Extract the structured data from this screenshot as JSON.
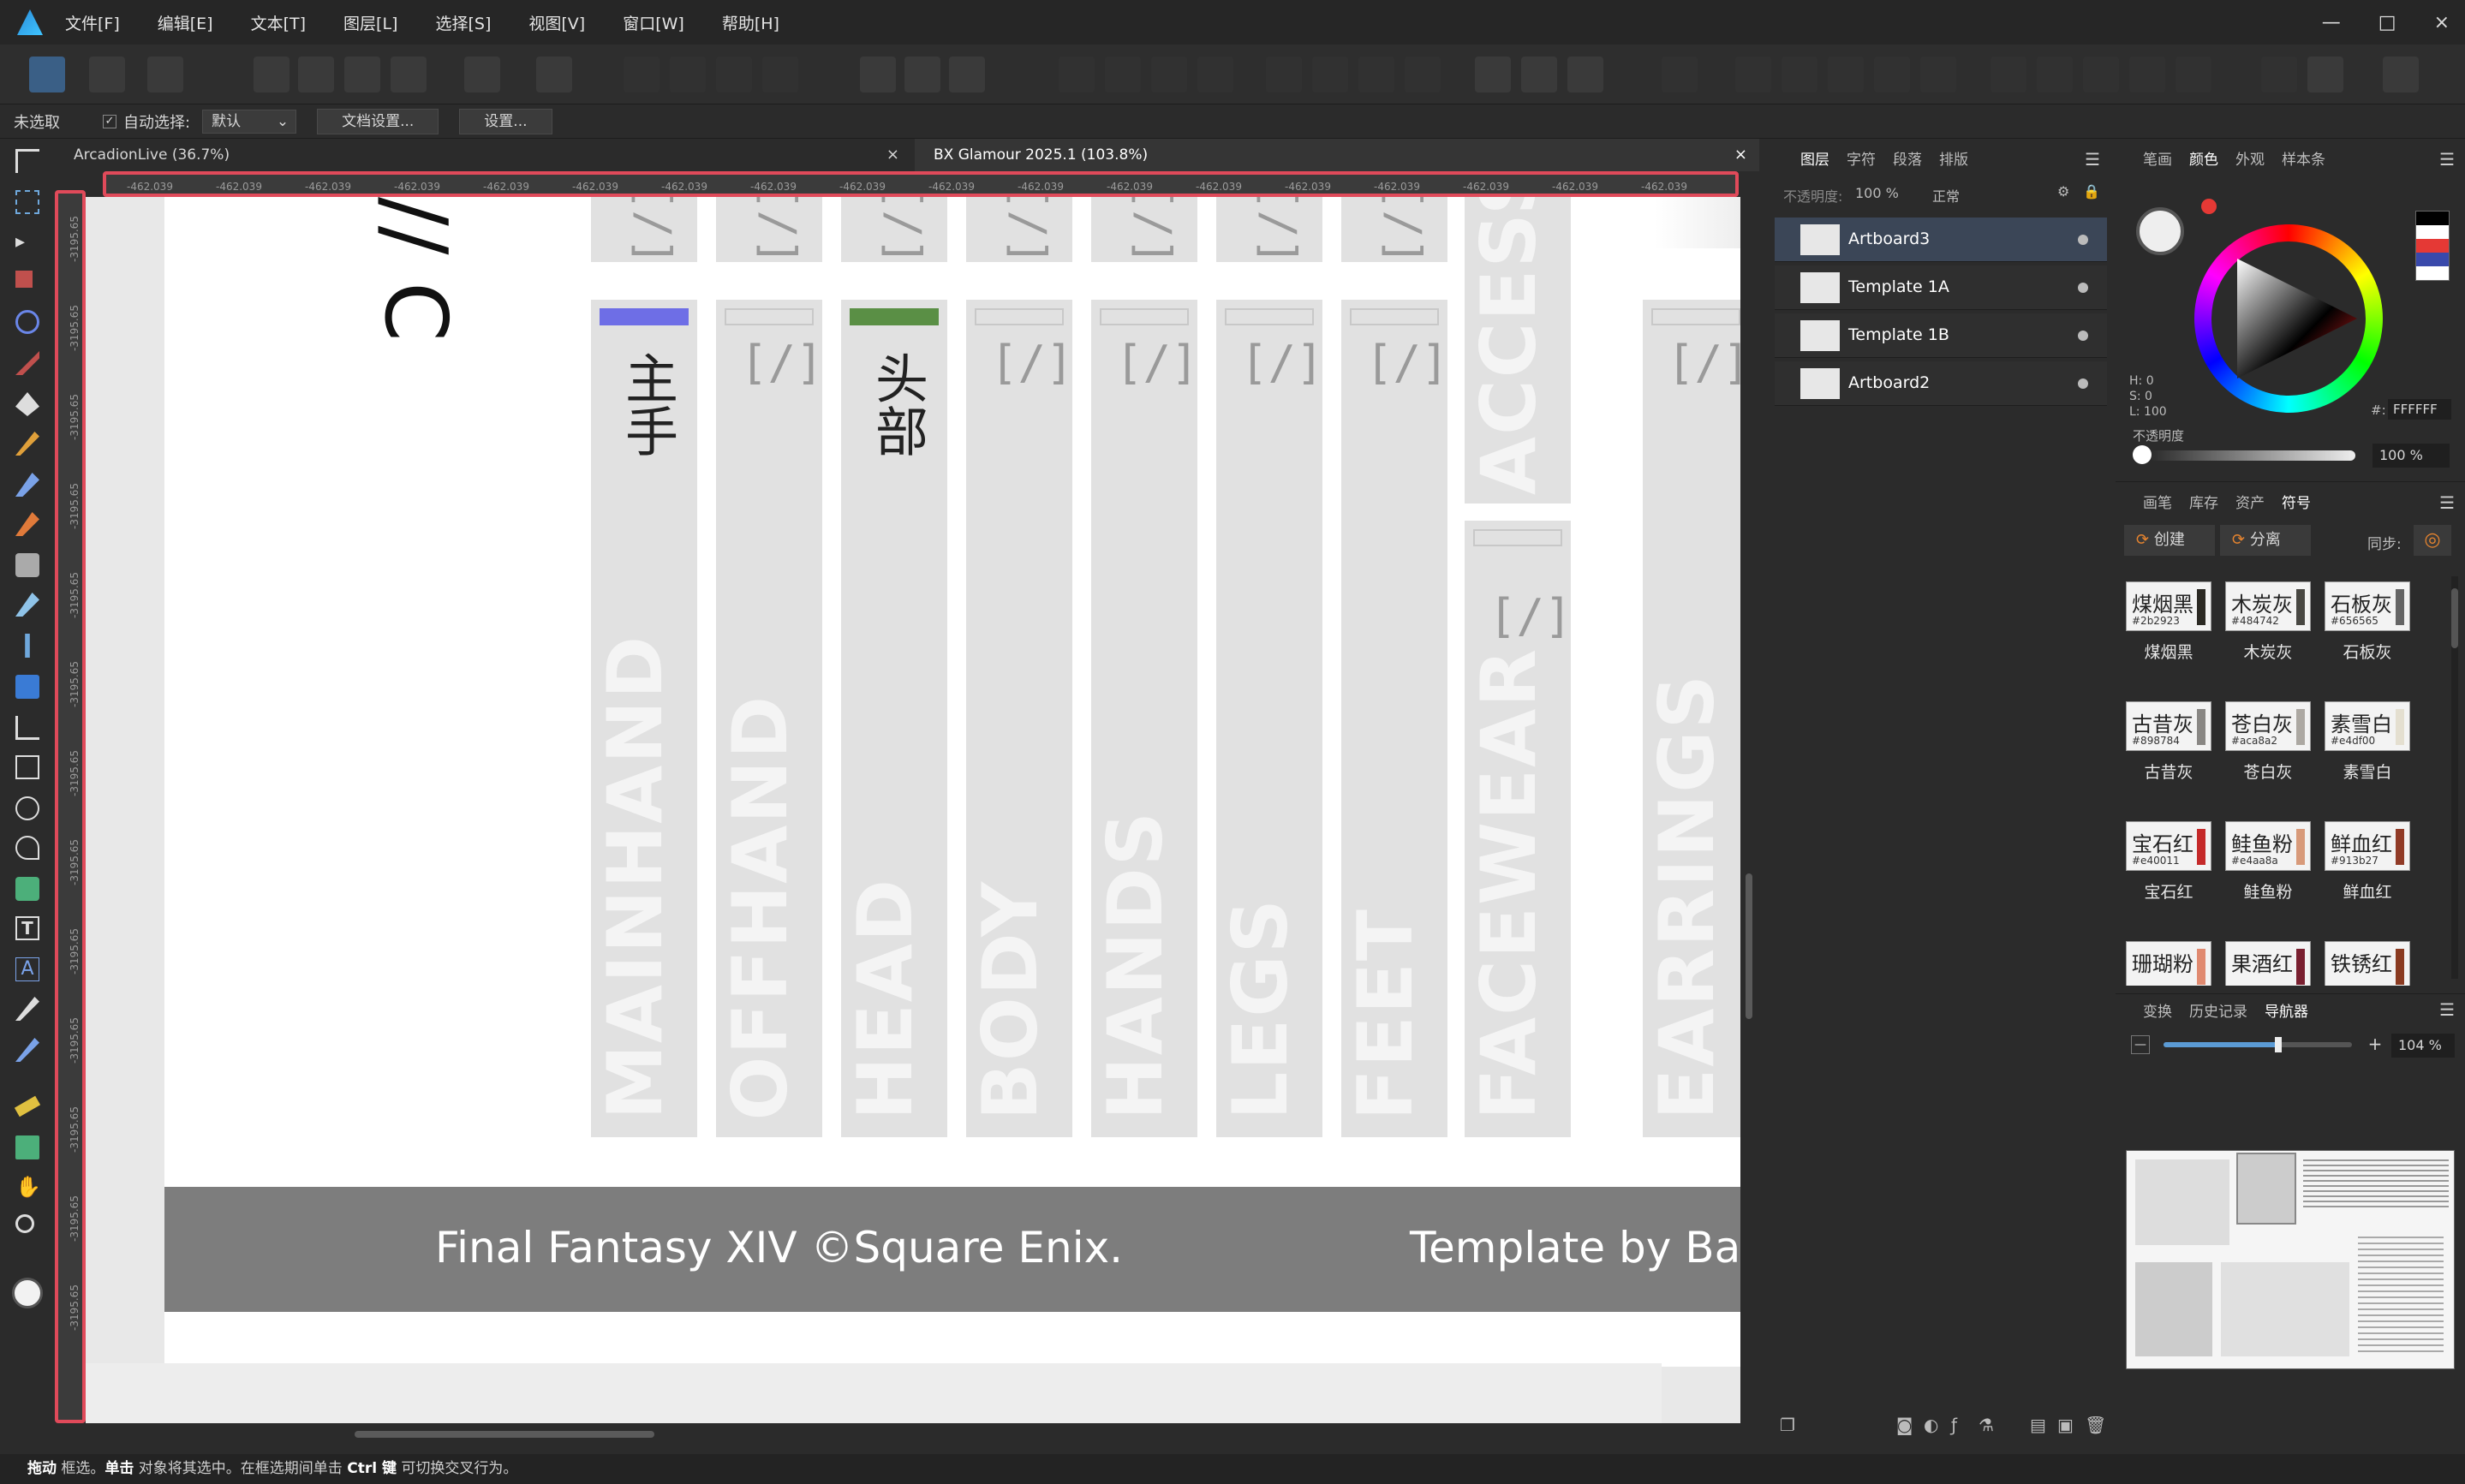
{
  "menubar": {
    "items": [
      "文件[F]",
      "编辑[E]",
      "文本[T]",
      "图层[L]",
      "选择[S]",
      "视图[V]",
      "窗口[W]",
      "帮助[H]"
    ],
    "window_controls": [
      "—",
      "□",
      "×"
    ]
  },
  "context_bar": {
    "selection_status": "未选取",
    "auto_select_label": "自动选择:",
    "auto_select_value": "默认",
    "doc_settings_label": "文档设置...",
    "settings_label": "设置..."
  },
  "doc_tabs": [
    {
      "label": "ArcadionLive (36.7%)",
      "close": "×"
    },
    {
      "label": "BX Glamour 2025.1 (103.8%)",
      "close": "×"
    }
  ],
  "ruler": {
    "h_label": "-462.039",
    "v_label": "-3195.65"
  },
  "artboard": {
    "columns": [
      {
        "en": "MAINHAND",
        "cn": "主手",
        "accent": "#6e6ee6"
      },
      {
        "en": "OFFHAND",
        "cn": "",
        "accent": ""
      },
      {
        "en": "HEAD",
        "cn": "头部",
        "accent": "#5a8f45"
      },
      {
        "en": "BODY",
        "cn": "",
        "accent": ""
      },
      {
        "en": "HANDS",
        "cn": "",
        "accent": ""
      },
      {
        "en": "LEGS",
        "cn": "",
        "accent": ""
      },
      {
        "en": "FEET",
        "cn": "",
        "accent": ""
      },
      {
        "en": "FACEWEAR",
        "cn": "",
        "accent": ""
      },
      {
        "en": "EARRINGS",
        "cn": "",
        "accent": ""
      }
    ],
    "accessory_label": "ACCESSO",
    "bracket_glyph": "[/]",
    "slash_title": "// C",
    "footer_left": "Final Fantasy XIV  ©Square Enix.",
    "footer_right": "Template by Barr"
  },
  "layers_panel": {
    "tabs": [
      "图层",
      "字符",
      "段落",
      "排版"
    ],
    "active_tab": "图层",
    "opacity_label": "不透明度:",
    "opacity_value": "100 %",
    "blend_mode": "正常",
    "layers": [
      {
        "name": "Artboard3",
        "selected": true
      },
      {
        "name": "Template 1A",
        "selected": false
      },
      {
        "name": "Template 1B",
        "selected": false
      },
      {
        "name": "Artboard2",
        "selected": false
      }
    ]
  },
  "color_panel": {
    "tabs": [
      "笔画",
      "颜色",
      "外观",
      "样本条"
    ],
    "active_tab": "颜色",
    "h": "H: 0",
    "s": "S: 0",
    "l": "L: 100",
    "hex_label": "#:",
    "hex_value": "FFFFFF",
    "opacity_label": "不透明度",
    "opacity_value": "100 %"
  },
  "symbols_panel": {
    "tabs": [
      "画笔",
      "库存",
      "资产",
      "符号"
    ],
    "active_tab": "符号",
    "create_label": "创建",
    "detach_label": "分离",
    "sync_label": "同步:",
    "swatches": [
      {
        "name": "煤烟黑",
        "hex": "#2b2923",
        "bar": "#2b2923"
      },
      {
        "name": "木炭灰",
        "hex": "#484742",
        "bar": "#484742"
      },
      {
        "name": "石板灰",
        "hex": "#656565",
        "bar": "#656565"
      },
      {
        "name": "古昔灰",
        "hex": "#898784",
        "bar": "#898784"
      },
      {
        "name": "苍白灰",
        "hex": "#aca8a2",
        "bar": "#aca8a2"
      },
      {
        "name": "素雪白",
        "hex": "#e4df00",
        "bar": "#e4dfd0"
      },
      {
        "name": "宝石红",
        "hex": "#e40011",
        "bar": "#c52a2a"
      },
      {
        "name": "鲑鱼粉",
        "hex": "#e4aa8a",
        "bar": "#d89a7a"
      },
      {
        "name": "鲜血红",
        "hex": "#913b27",
        "bar": "#913b27"
      },
      {
        "name": "珊瑚粉",
        "hex": "",
        "bar": "#e08a70"
      },
      {
        "name": "果酒红",
        "hex": "",
        "bar": "#7a2030"
      },
      {
        "name": "铁锈红",
        "hex": "",
        "bar": "#8a3a20"
      }
    ]
  },
  "navigator_panel": {
    "tabs": [
      "变换",
      "历史记录",
      "导航器"
    ],
    "active_tab": "导航器",
    "zoom_minus": "—",
    "zoom_plus": "+",
    "zoom_value": "104 %",
    "zoom_fraction": 0.61
  },
  "status_bar": {
    "drag_bold": "拖动",
    "drag_text": " 框选。",
    "click_bold": "单击",
    "click_text": " 对象将其选中。在框选期间单击 ",
    "ctrl_bold": "Ctrl 键",
    "ctrl_text": " 可切换交叉行为。"
  },
  "colors": {
    "accent_blue": "#2a8cd9",
    "highlight_red": "#e04a5a",
    "layer_selected": "#3b4657"
  }
}
